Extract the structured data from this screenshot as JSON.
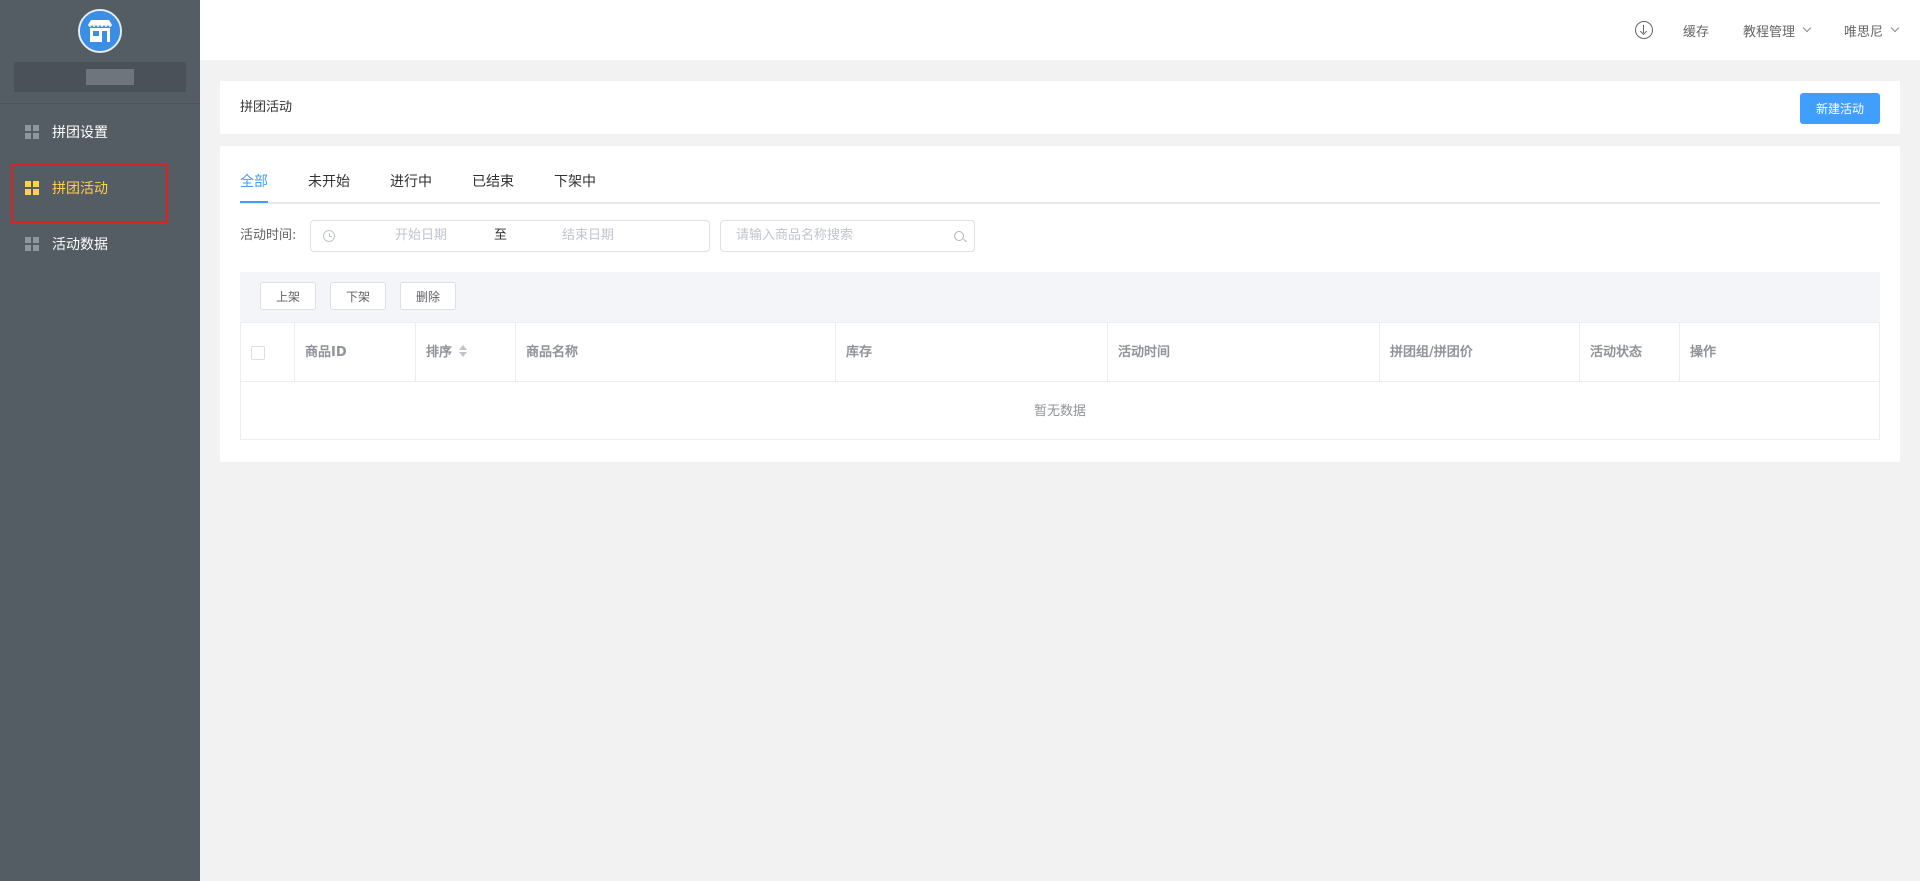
{
  "sidebar": {
    "logo_icon": "shop-store-icon",
    "items": [
      {
        "label": "拼团设置",
        "icon": "grid-icon",
        "active": false
      },
      {
        "label": "拼团活动",
        "icon": "grid-icon",
        "active": true
      },
      {
        "label": "活动数据",
        "icon": "grid-icon",
        "active": false
      }
    ]
  },
  "header": {
    "download_icon": "download-circle-icon",
    "cache_label": "缓存",
    "tutorial_label": "教程管理",
    "user_label": "唯思尼"
  },
  "page": {
    "title": "拼团活动",
    "new_button": "新建活动"
  },
  "tabs": [
    "全部",
    "未开始",
    "进行中",
    "已结束",
    "下架中"
  ],
  "filter": {
    "time_label": "活动时间:",
    "start_placeholder": "开始日期",
    "separator": "至",
    "end_placeholder": "结束日期",
    "search_placeholder": "请输入商品名称搜索"
  },
  "actions": {
    "on_shelf": "上架",
    "off_shelf": "下架",
    "delete": "删除"
  },
  "table": {
    "columns": [
      "商品ID",
      "排序",
      "商品名称",
      "库存",
      "活动时间",
      "拼团组/拼团价",
      "活动状态",
      "操作"
    ],
    "empty_text": "暂无数据"
  },
  "colors": {
    "sidebar_bg": "#545c64",
    "active_menu": "#ffd04b",
    "primary": "#409eff",
    "highlight_border": "#e02020"
  }
}
